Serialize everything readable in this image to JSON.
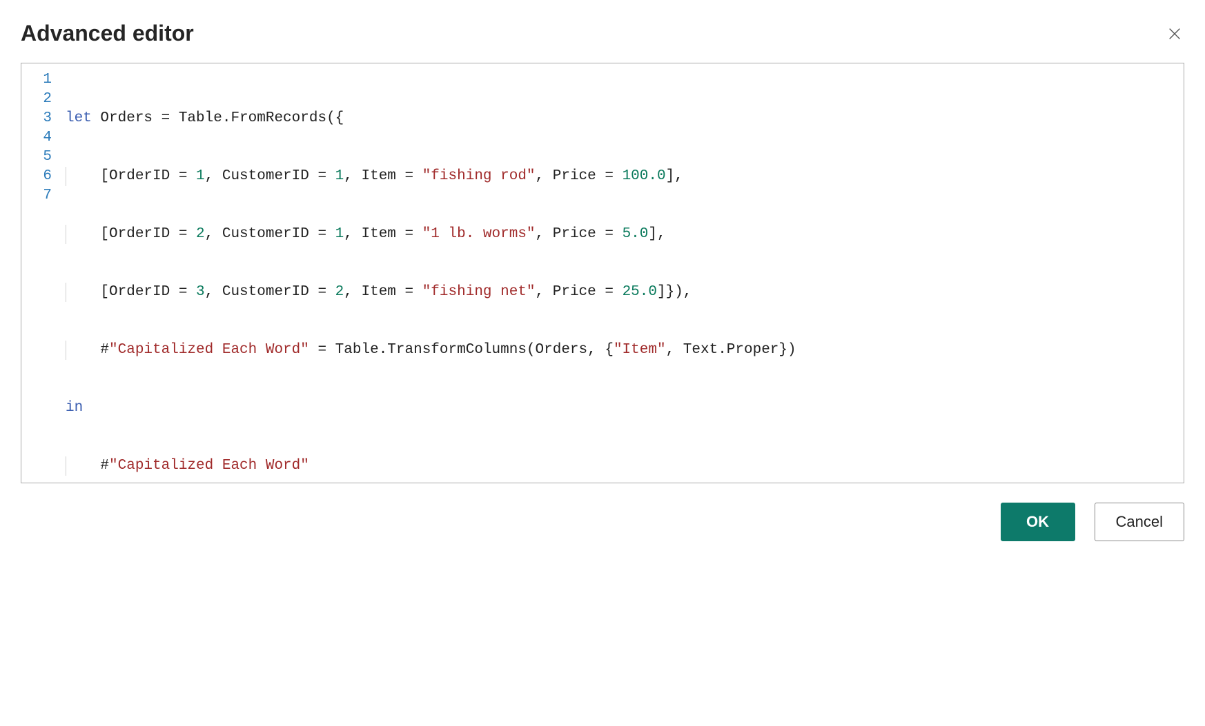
{
  "dialog": {
    "title": "Advanced editor",
    "ok_label": "OK",
    "cancel_label": "Cancel"
  },
  "editor": {
    "line_numbers": [
      "1",
      "2",
      "3",
      "4",
      "5",
      "6",
      "7"
    ],
    "code": {
      "l1": {
        "a": "let",
        "b": " Orders = Table.FromRecords({"
      },
      "l2": {
        "a": "    [OrderID = ",
        "n1": "1",
        "b": ", CustomerID = ",
        "n2": "1",
        "c": ", Item = ",
        "s": "\"fishing rod\"",
        "d": ", Price = ",
        "n3": "100.0",
        "e": "],"
      },
      "l3": {
        "a": "    [OrderID = ",
        "n1": "2",
        "b": ", CustomerID = ",
        "n2": "1",
        "c": ", Item = ",
        "s": "\"1 lb. worms\"",
        "d": ", Price = ",
        "n3": "5.0",
        "e": "],"
      },
      "l4": {
        "a": "    [OrderID = ",
        "n1": "3",
        "b": ", CustomerID = ",
        "n2": "2",
        "c": ", Item = ",
        "s": "\"fishing net\"",
        "d": ", Price = ",
        "n3": "25.0",
        "e": "]}),"
      },
      "l5": {
        "a": "    #",
        "s1": "\"Capitalized Each Word\"",
        "b": " = Table.TransformColumns(Orders, {",
        "s2": "\"Item\"",
        "c": ", Text.Proper})"
      },
      "l6": {
        "a": "in"
      },
      "l7": {
        "a": "    #",
        "s": "\"Capitalized Each Word\""
      }
    }
  }
}
